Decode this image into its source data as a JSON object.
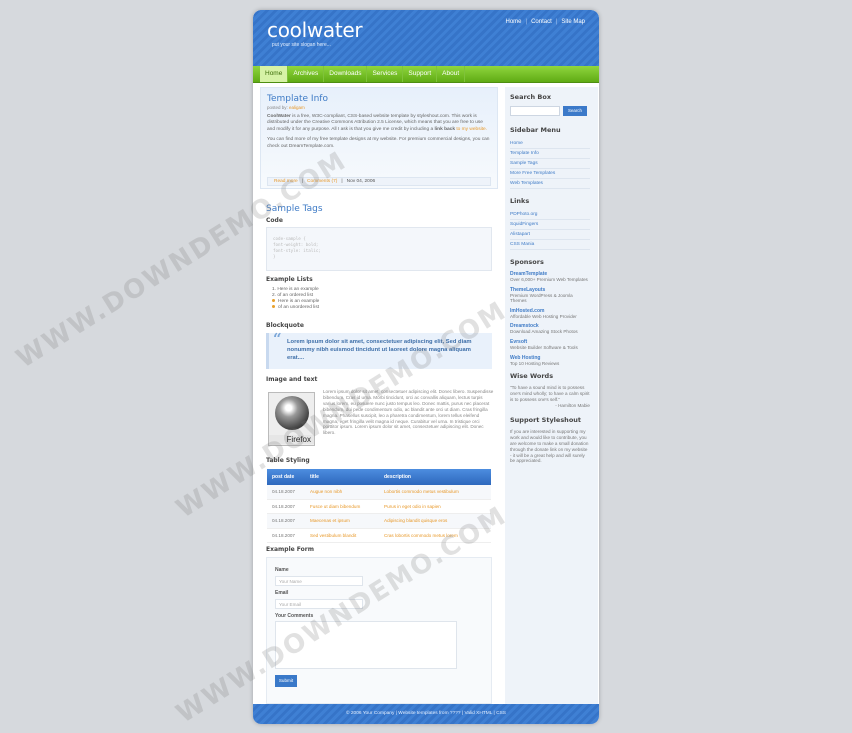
{
  "header": {
    "logo": "coolwater",
    "slogan": "put your site slogan here...",
    "toplinks": [
      "Home",
      "Contact",
      "Site Map"
    ]
  },
  "nav": {
    "items": [
      "Home",
      "Archives",
      "Downloads",
      "Services",
      "Support",
      "About"
    ]
  },
  "post": {
    "title": "Template Info",
    "posted": "posted by:",
    "author": "ealigam",
    "p1_lead": "CoolWater",
    "p1": "is a free, W3C-compliant, CSS-based website template by styleshout.com. This work is distributed under the Creative Commons Attribution 2.5 License, which means that you are free to use and modify it for any purpose. All I ask is that you give me credit by including a",
    "p1_bold": "link back",
    "p1_tail": "to my website.",
    "p2": "You can find more of my free template designs at my website. For premium commercial designs, you can check out DreamTemplate.com.",
    "meta": [
      "Read more",
      "Comments (7)",
      "Nov 04, 2006"
    ]
  },
  "sample": {
    "title": "Sample Tags",
    "code_label": "Code",
    "code_lines": [
      "code-sample {",
      "font-weight: bold;",
      "font-style: italic;",
      "}"
    ],
    "lists_label": "Example Lists",
    "ordered": [
      "1. Here is an example",
      "2. of an ordered list"
    ],
    "unordered": [
      "Here is an example",
      "of an unordered list"
    ],
    "blockquote_label": "Blockquote",
    "quote": "Lorem ipsum dolor sit amet, consectetuer adipiscing elit, Sed diam nonummy nibh euismod tincidunt ut laoreet dolore magna aliquam erat....",
    "image_label": "Image and text",
    "image_caption": "Firefox",
    "image_text": "Lorem ipsum dolor sit amet, consectetuer adipiscing elit. Donec libero. Suspendisse bibendum. Cras id urna. Morbi tincidunt, orci ac convallis aliquam, lectus turpis varius lorem, eu posuere nunc justo tempus leo. Donec mattis, purus nec placerat bibendum, dui pede condimentum odio, ac blandit ante orci ut diam. Cras fringilla magna. Phasellus suscipit, leo a pharetra condimentum, lorem tellus eleifend magna, eget fringilla velit magna id neque. Curabitur vel urna. In tristique orci porttitor ipsum. Lorem ipsum dolor sit amet, consectetuer adipiscing elit. Donec libero.",
    "table_label": "Table Styling",
    "table_headers": [
      "post date",
      "title",
      "description"
    ],
    "table_rows": [
      [
        "04.18.2007",
        "Augue non nibh",
        "Lobortis commodo metus vestibulum"
      ],
      [
        "04.18.2007",
        "Fusce ut diam bibendum",
        "Purus in eget odio in sapien"
      ],
      [
        "04.18.2007",
        "Maecenas et ipsum",
        "Adipiscing blandit quisque eros"
      ],
      [
        "04.18.2007",
        "Sed vestibulum blandit",
        "Cras lobortis commodo metus lorem"
      ]
    ],
    "form_label": "Example Form",
    "form_name_label": "Name",
    "form_name_ph": "Your Name",
    "form_email_label": "Email",
    "form_email_ph": "Your Email",
    "form_comments_label": "Your Comments",
    "form_submit": "Submit"
  },
  "sidebar": {
    "search_title": "Search Box",
    "search_button": "Search",
    "menu_title": "Sidebar Menu",
    "menu": [
      "Home",
      "Template Info",
      "Sample Tags",
      "More Free Templates",
      "Web Templates"
    ],
    "links_title": "Links",
    "links": [
      "PDPhoto.org",
      "SquidFingers",
      "Alistapart",
      "CSS Mania"
    ],
    "sponsors_title": "Sponsors",
    "sponsors": [
      {
        "t": "DreamTemplate",
        "d": "Over 6,000+ Premium Web Templates"
      },
      {
        "t": "ThemeLayouts",
        "d": "Premium WordPress & Joomla Themes"
      },
      {
        "t": "ImHosted.com",
        "d": "Affordable Web Hosting Provider"
      },
      {
        "t": "Dreamstock",
        "d": "Download Amazing Stock Photos"
      },
      {
        "t": "Evrsoft",
        "d": "Website Builder Software & Tools"
      },
      {
        "t": "Web Hosting",
        "d": "Top 10 Hosting Reviews"
      }
    ],
    "wise_title": "Wise Words",
    "wise": "\"To have a sound mind is to possess one's mind wholly; to have a calm spirit is to possess one's self.\"",
    "wise_author": "- Hamilton Mabie",
    "support_title": "Support Styleshout",
    "support": "If you are interested in supporting my work and would like to contribute, you are welcome to make a small donation through the donate link on my website - it will be a great help and will surely be appreciated."
  },
  "footer": {
    "text": "© 2006 Your Company | Website templates from ???? | Valid XHTML | CSS"
  },
  "watermark": "WWW.DOWNDEMO.COM"
}
